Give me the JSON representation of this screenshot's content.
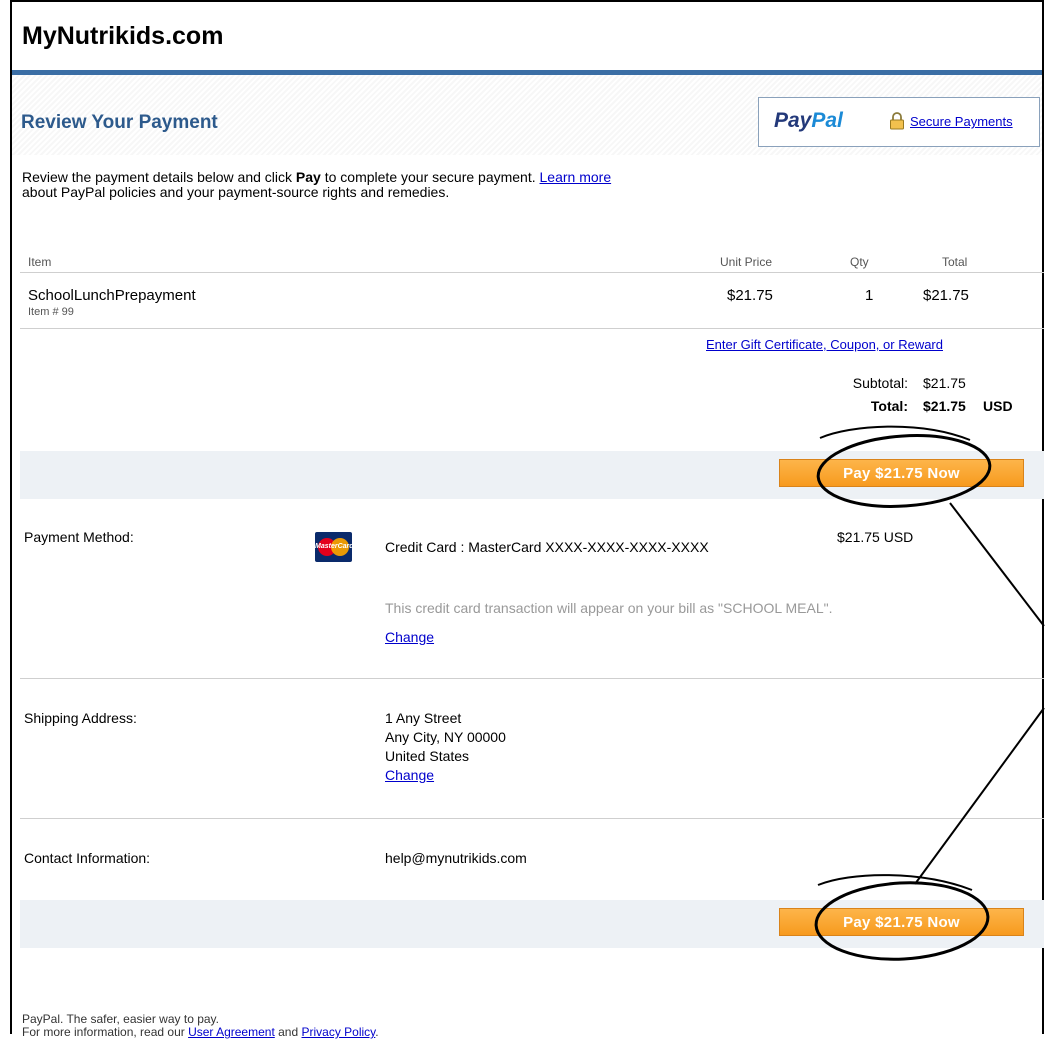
{
  "site": {
    "title": "MyNutrikids.com"
  },
  "review": {
    "title": "Review Your Payment"
  },
  "paypal": {
    "logo_pay": "Pay",
    "logo_pal": "Pal",
    "secure_label": "Secure Payments"
  },
  "intro": {
    "part1": "Review the payment details below and click ",
    "bold": "Pay",
    "part2": " to complete your secure payment. ",
    "learn_more": "Learn more",
    "part3": "about PayPal policies and your payment-source rights and remedies."
  },
  "table": {
    "headers": {
      "item": "Item",
      "unit_price": "Unit Price",
      "qty": "Qty",
      "total": "Total"
    },
    "row": {
      "name": "SchoolLunchPrepayment",
      "item_number": "Item # 99",
      "unit_price": "$21.75",
      "qty": "1",
      "total": "$21.75"
    }
  },
  "coupon_link": "Enter Gift Certificate, Coupon, or Reward",
  "totals": {
    "subtotal_label": "Subtotal:",
    "subtotal": "$21.75",
    "total_label": "Total:",
    "total": "$21.75",
    "currency": "USD"
  },
  "pay_button": "Pay $21.75 Now",
  "payment_method": {
    "label": "Payment Method:",
    "card_text": "Credit Card : MasterCard XXXX-XXXX-XXXX-XXXX",
    "card_icon": "mastercard-icon",
    "card_icon_text": "MasterCard",
    "amount": "$21.75 USD",
    "statement_note": "This credit card transaction will appear on your bill as \"SCHOOL MEAL\".",
    "change": "Change"
  },
  "shipping": {
    "label": "Shipping Address:",
    "line1": "1 Any Street",
    "line2": "Any City, NY 00000",
    "line3": "United States",
    "change": "Change"
  },
  "contact": {
    "label": "Contact Information:",
    "email": "help@mynutrikids.com"
  },
  "footer": {
    "line1": "PayPal. The safer, easier way to pay.",
    "line2_pre": "For more information, read our ",
    "user_agreement": "User Agreement",
    "and": " and ",
    "privacy_policy": "Privacy Policy",
    "period": "."
  },
  "colors": {
    "header_rule": "#3b6ea5",
    "title_blue": "#2d5a8c",
    "button_orange": "#f7a130",
    "band": "#edf1f5"
  }
}
